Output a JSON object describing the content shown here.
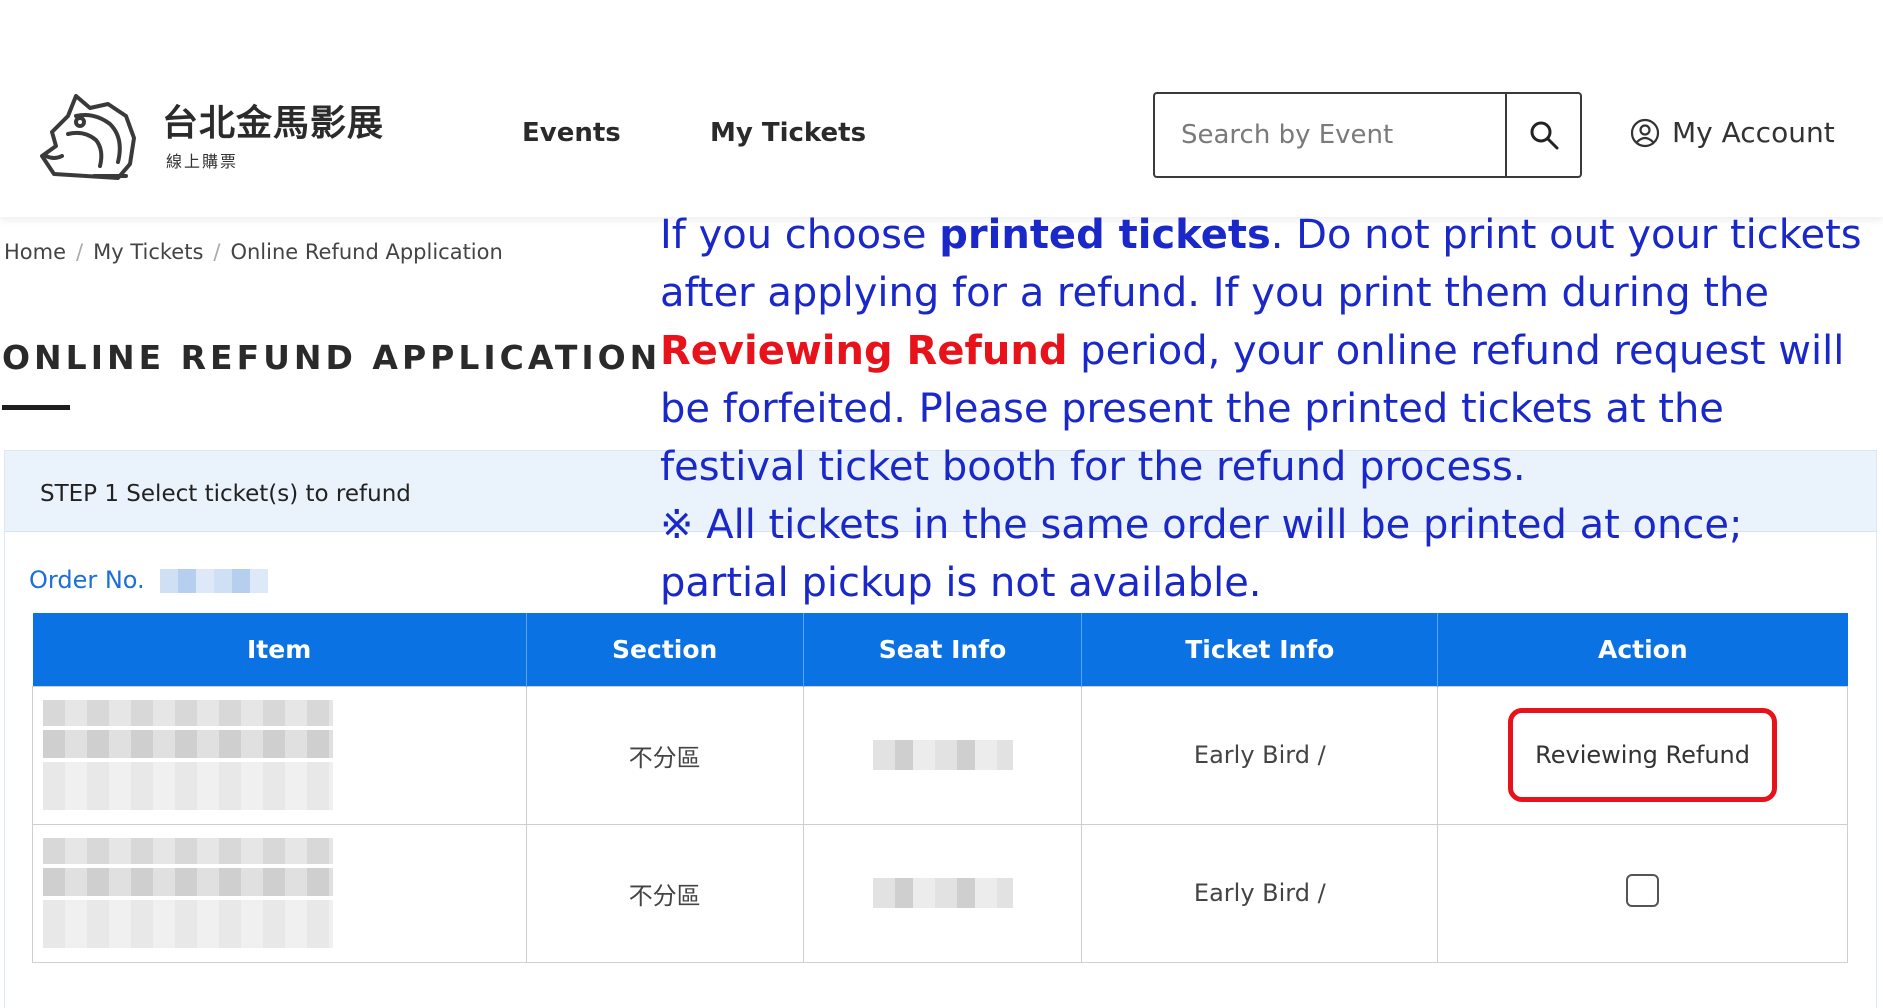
{
  "header": {
    "logo_title": "台北金馬影展",
    "logo_sub": "線上購票",
    "nav": [
      {
        "label": "Events"
      },
      {
        "label": "My Tickets"
      }
    ],
    "search": {
      "placeholder": "Search by Event",
      "value": ""
    },
    "account_label": "My Account"
  },
  "breadcrumb": [
    "Home",
    "My Tickets",
    "Online Refund Application"
  ],
  "page_title": "ONLINE REFUND APPLICATION",
  "panel": {
    "step_label": "STEP 1 Select ticket(s) to refund",
    "order_label": "Order No."
  },
  "table": {
    "headers": [
      "Item",
      "Section",
      "Seat Info",
      "Ticket Info",
      "Action"
    ],
    "rows": [
      {
        "section": "不分區",
        "ticket_info": "Early Bird /",
        "action": "Reviewing Refund"
      },
      {
        "section": "不分區",
        "ticket_info": "Early Bird /",
        "action": ""
      }
    ]
  },
  "overlay": {
    "p1_pre": "If you choose ",
    "p1_bold": "printed tickets",
    "p1_mid": ". Do not print out your tickets after applying for a refund. If you print them during the ",
    "p1_red": "Reviewing Refund",
    "p1_post": " period, your online refund request will be forfeited. Please present the printed tickets at the festival ticket booth for the refund process.",
    "p2": "※ All tickets in the same order will be printed at once; partial pickup is not available."
  },
  "colors": {
    "table_header": "#0b72e3",
    "overlay_text": "#1a28c9",
    "highlight_red": "#e8121a",
    "link_blue": "#1d6fd8",
    "panel_header_bg": "#eaf2fb"
  },
  "icons": [
    "horse-logo-icon",
    "search-icon",
    "account-icon"
  ]
}
